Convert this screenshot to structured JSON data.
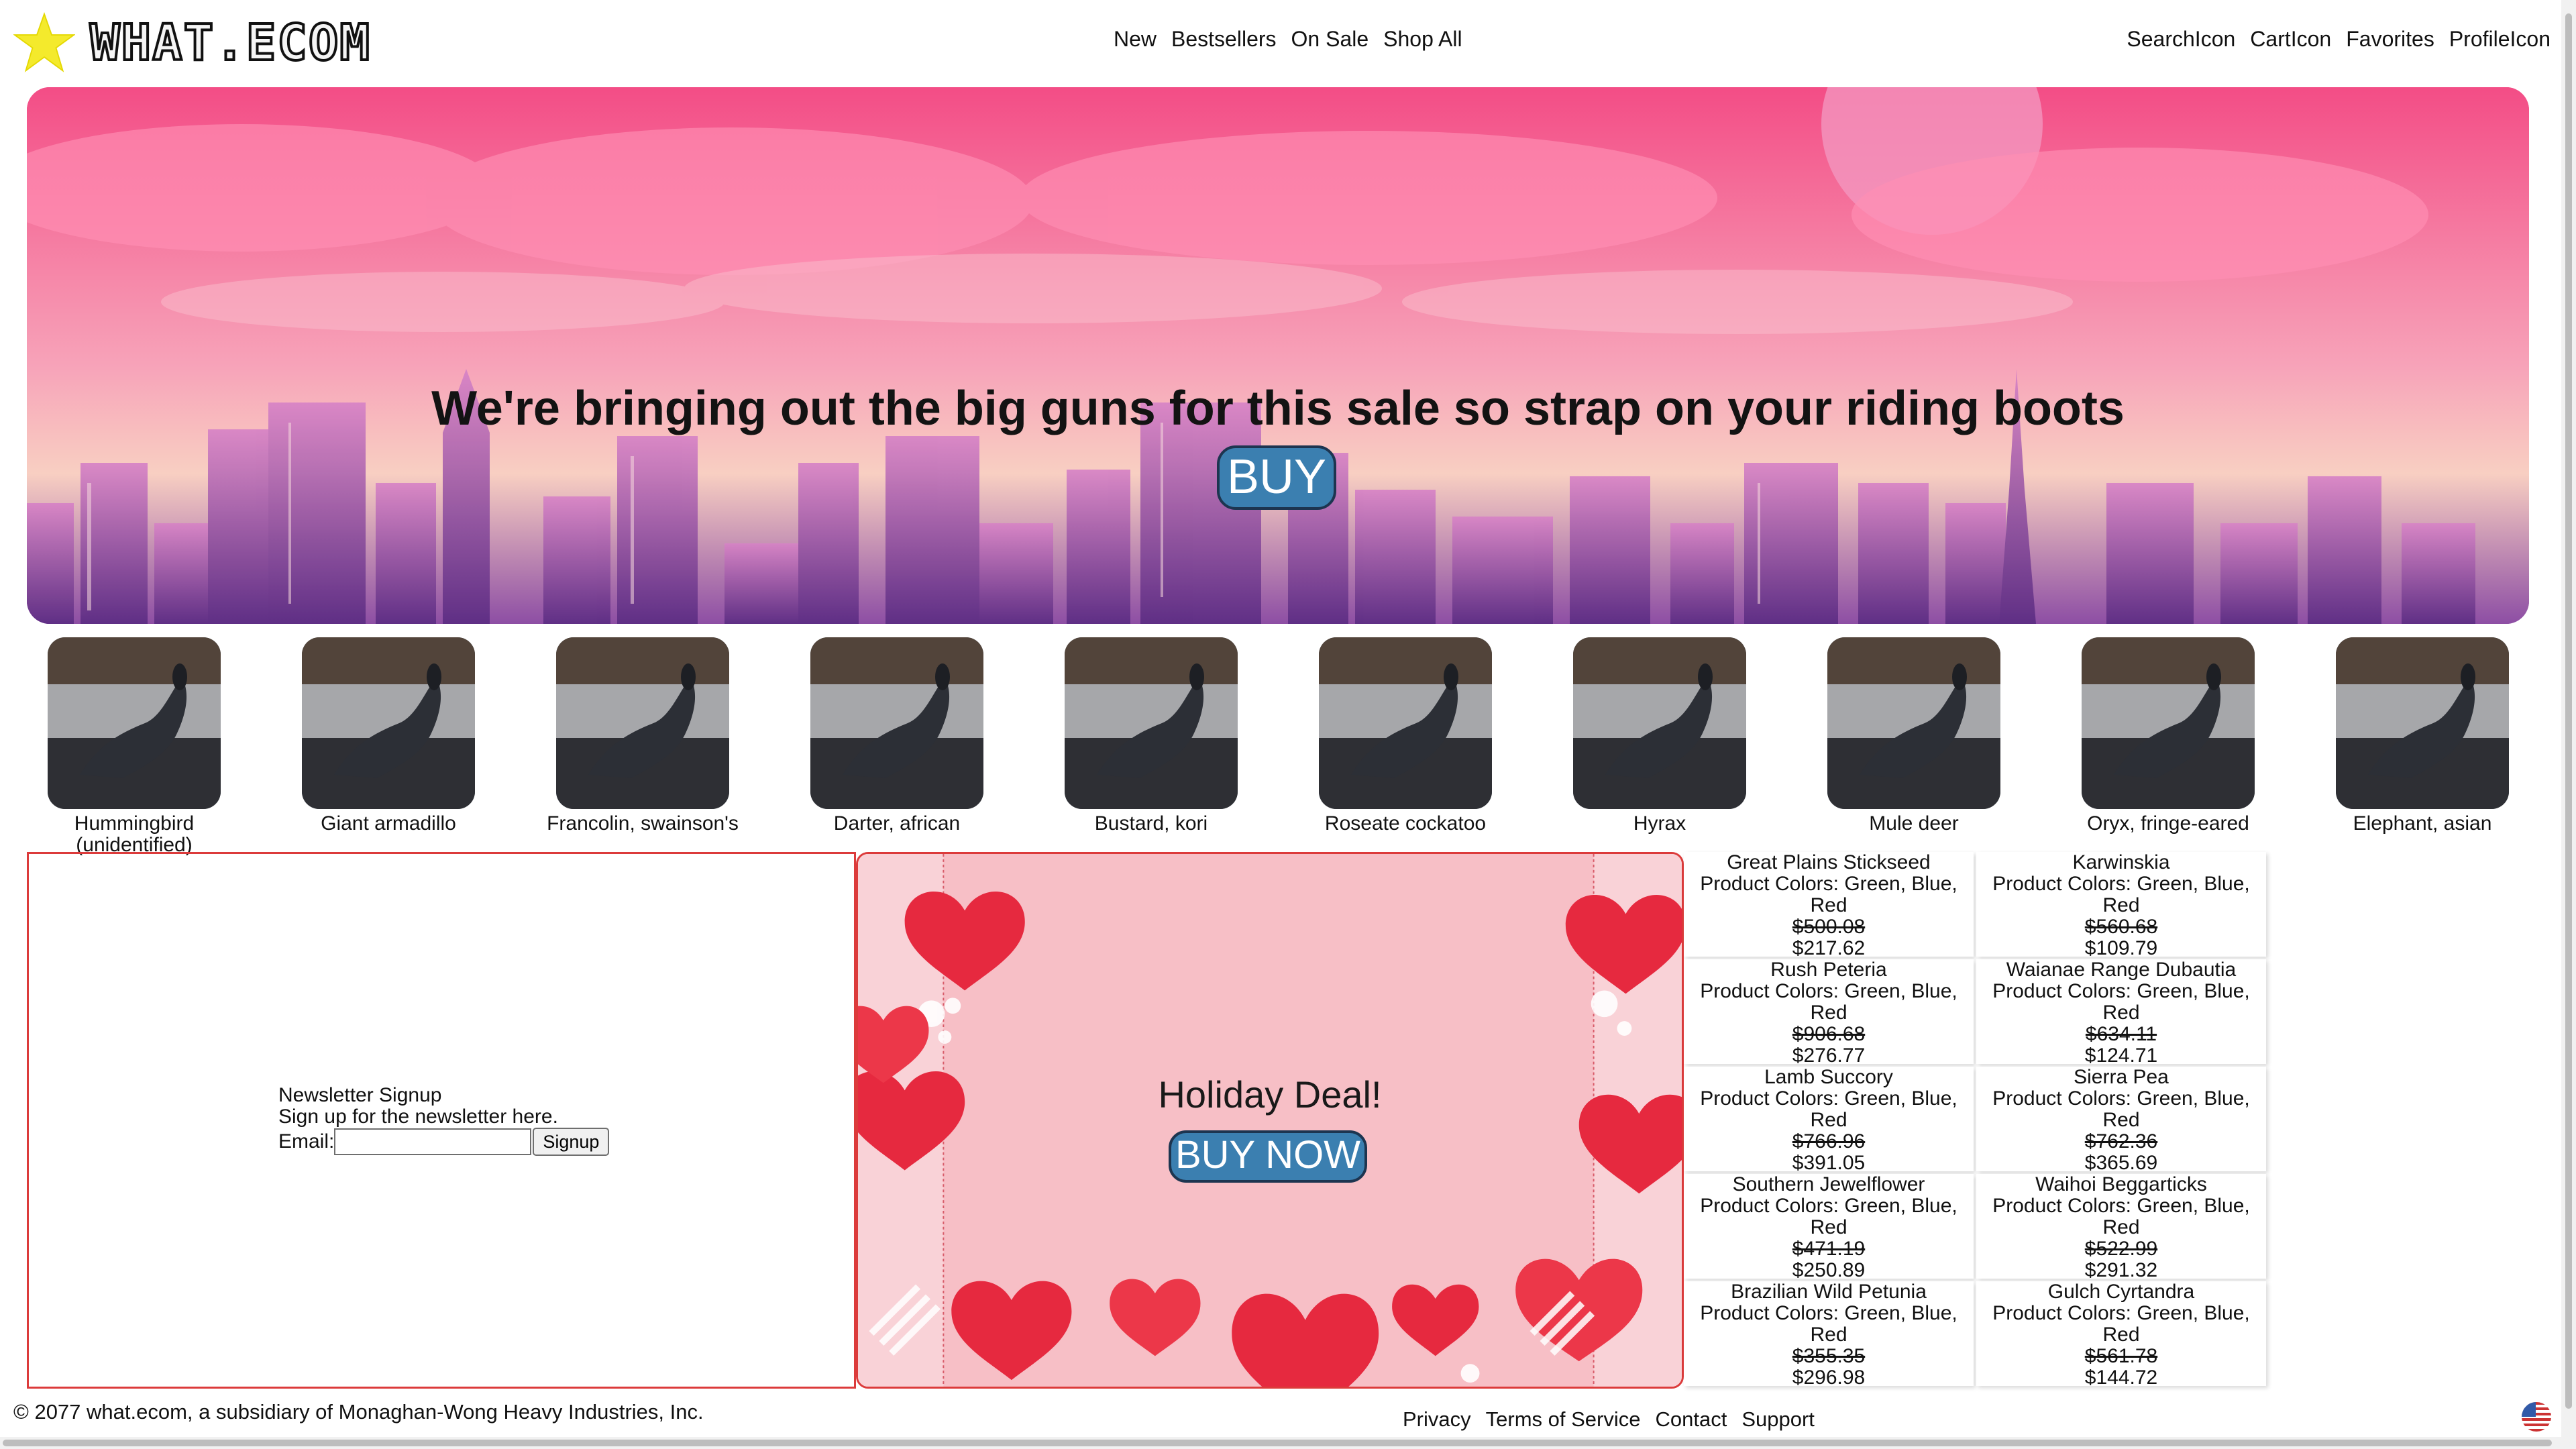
{
  "brand": {
    "name": "WHAT.ECOM"
  },
  "nav": {
    "center": [
      "New",
      "Bestsellers",
      "On Sale",
      "Shop All"
    ],
    "right": [
      "SearchIcon",
      "CartIcon",
      "Favorites",
      "ProfileIcon"
    ]
  },
  "hero": {
    "title": "We're bringing out the big guns for this sale so strap on your riding boots",
    "button": "BUY"
  },
  "thumbnails": [
    "Hummingbird (unidentified)",
    "Giant armadillo",
    "Francolin, swainson's",
    "Darter, african",
    "Bustard, kori",
    "Roseate cockatoo",
    "Hyrax",
    "Mule deer",
    "Oryx, fringe-eared",
    "Elephant, asian"
  ],
  "newsletter": {
    "title": "Newsletter Signup",
    "description": "Sign up for the newsletter here.",
    "email_label": "Email:",
    "email_value": "",
    "button": "Signup"
  },
  "holiday": {
    "title": "Holiday Deal!",
    "button": "BUY NOW"
  },
  "products": [
    {
      "name": "Great Plains Stickseed",
      "colors": "Product Colors: Green, Blue, Red",
      "old_price": "$500.08",
      "price": "$217.62"
    },
    {
      "name": "Karwinskia",
      "colors": "Product Colors: Green, Blue, Red",
      "old_price": "$560.68",
      "price": "$109.79"
    },
    {
      "name": "Rush Peteria",
      "colors": "Product Colors: Green, Blue, Red",
      "old_price": "$906.68",
      "price": "$276.77"
    },
    {
      "name": "Waianae Range Dubautia",
      "colors": "Product Colors: Green, Blue, Red",
      "old_price": "$634.11",
      "price": "$124.71"
    },
    {
      "name": "Lamb Succory",
      "colors": "Product Colors: Green, Blue, Red",
      "old_price": "$766.96",
      "price": "$391.05"
    },
    {
      "name": "Sierra Pea",
      "colors": "Product Colors: Green, Blue, Red",
      "old_price": "$762.36",
      "price": "$365.69"
    },
    {
      "name": "Southern Jewelflower",
      "colors": "Product Colors: Green, Blue, Red",
      "old_price": "$471.19",
      "price": "$250.89"
    },
    {
      "name": "Waihoi Beggarticks",
      "colors": "Product Colors: Green, Blue, Red",
      "old_price": "$522.99",
      "price": "$291.32"
    },
    {
      "name": "Brazilian Wild Petunia",
      "colors": "Product Colors: Green, Blue, Red",
      "old_price": "$355.35",
      "price": "$296.98"
    },
    {
      "name": "Gulch Cyrtandra",
      "colors": "Product Colors: Green, Blue, Red",
      "old_price": "$561.78",
      "price": "$144.72"
    }
  ],
  "footer": {
    "copyright": "© 2077 what.ecom, a subsidiary of Monaghan-Wong Heavy Industries, Inc.",
    "links": [
      "Privacy",
      "Terms of Service",
      "Contact",
      "Support"
    ]
  },
  "icons": {
    "logo": "star-icon",
    "flag": "flag-icon"
  },
  "colors": {
    "accent": "#3b7fb0",
    "hero_pink": "#f56596",
    "box_red": "#dc3b3b"
  }
}
